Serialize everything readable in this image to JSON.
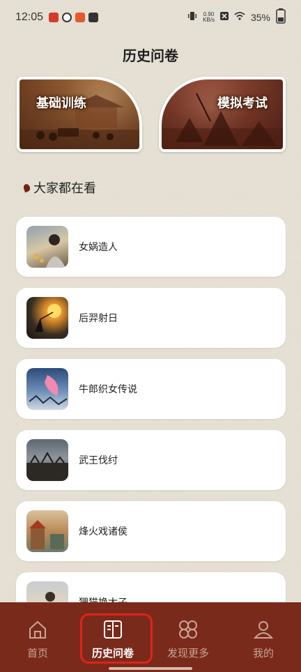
{
  "status_bar": {
    "time": "12:05",
    "net_speed_value": "0.90",
    "net_speed_unit": "KB/s",
    "battery": "35%"
  },
  "page": {
    "title": "历史问卷"
  },
  "banners": [
    {
      "label": "基础训练"
    },
    {
      "label": "模拟考试"
    }
  ],
  "section": {
    "title": "大家都在看"
  },
  "items": [
    {
      "title": "女娲造人",
      "icon": "nuwa-thumbnail"
    },
    {
      "title": "后羿射日",
      "icon": "houyi-thumbnail"
    },
    {
      "title": "牛郎织女传说",
      "icon": "niulang-zhinv-thumbnail"
    },
    {
      "title": "武王伐纣",
      "icon": "wuwang-thumbnail"
    },
    {
      "title": "烽火戏诸侯",
      "icon": "beacon-fire-thumbnail"
    },
    {
      "title": "狸猫换太子",
      "icon": "limao-thumbnail"
    }
  ],
  "nav": {
    "items": [
      {
        "label": "首页",
        "icon": "home-icon"
      },
      {
        "label": "历史问卷",
        "icon": "book-icon"
      },
      {
        "label": "发现更多",
        "icon": "grid-icon"
      },
      {
        "label": "我的",
        "icon": "user-icon"
      }
    ],
    "active_index": 1
  },
  "colors": {
    "nav_bg": "#7a2a1a",
    "highlight": "#e0231c",
    "page_bg": "#e6e1d4"
  }
}
